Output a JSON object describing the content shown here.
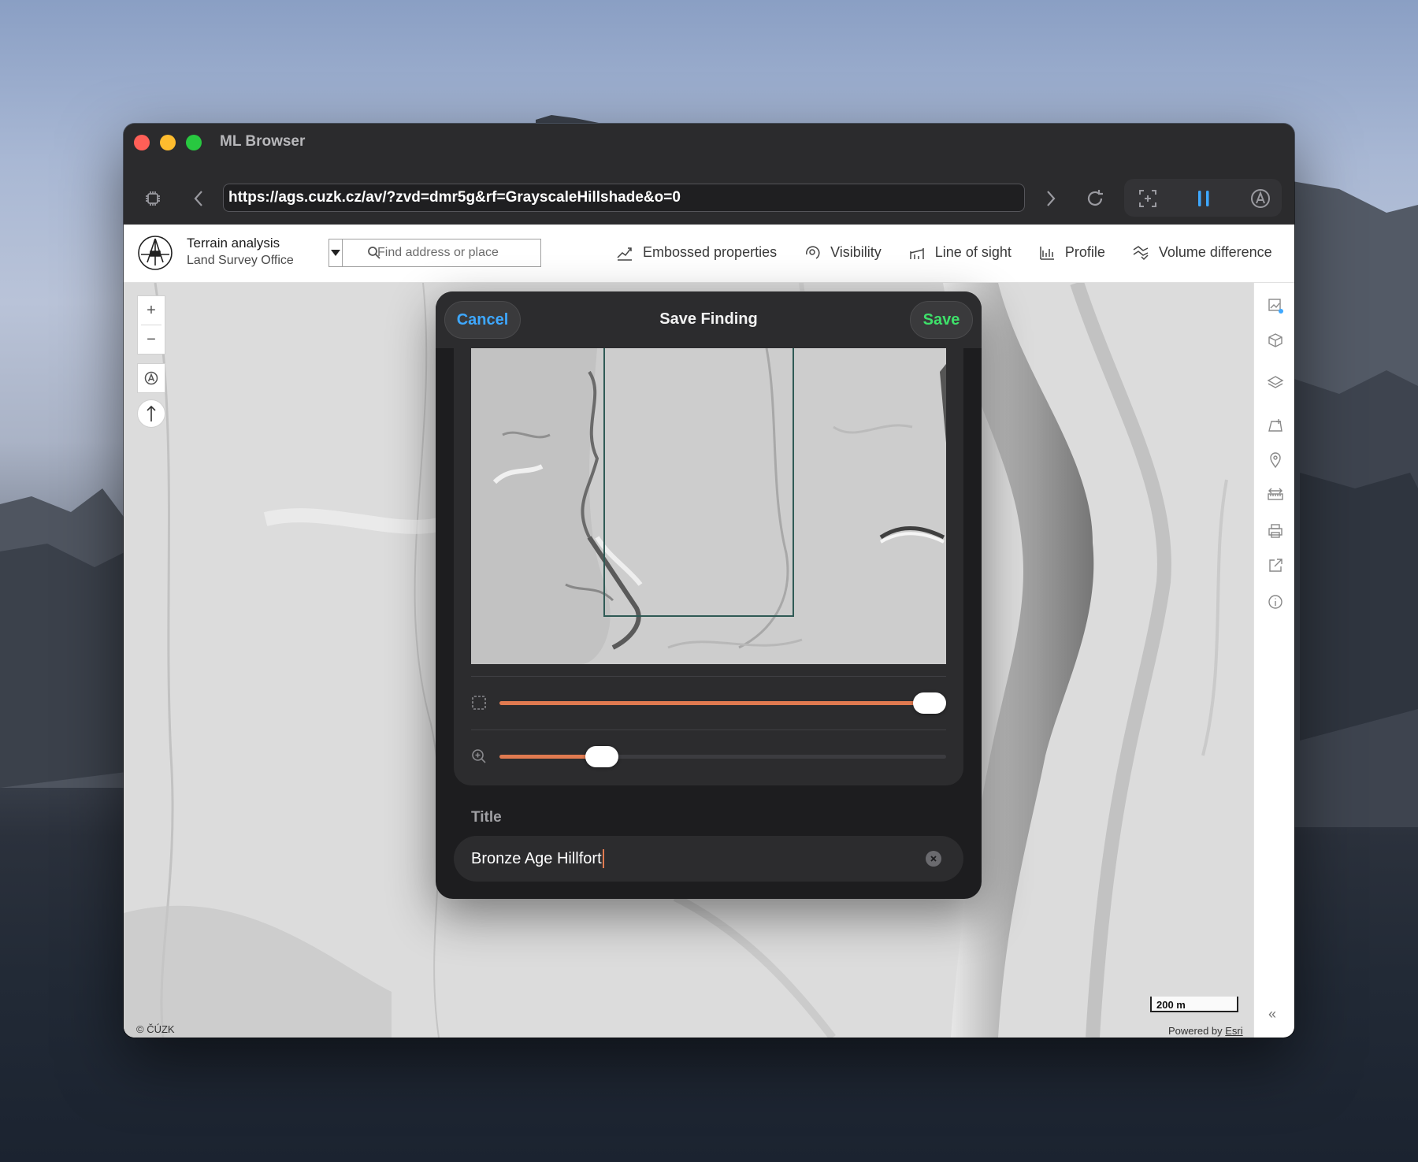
{
  "window": {
    "app_title": "ML Browser"
  },
  "toolbar": {
    "url": "https://ags.cuzk.cz/av/?zvd=dmr5g&rf=GrayscaleHillshade&o=0"
  },
  "app": {
    "title": "Terrain analysis",
    "subtitle": "Land Survey Office",
    "search_placeholder": "Find address or place",
    "nav": [
      {
        "label": "Embossed properties",
        "icon": "emboss-icon"
      },
      {
        "label": "Visibility",
        "icon": "visibility-icon"
      },
      {
        "label": "Line of sight",
        "icon": "line-of-sight-icon"
      },
      {
        "label": "Profile",
        "icon": "profile-icon"
      },
      {
        "label": "Volume difference",
        "icon": "volume-difference-icon"
      }
    ]
  },
  "map": {
    "zoom_in": "+",
    "zoom_out": "−",
    "scale_label": "200 m",
    "attribution_left": "© ČÚZK",
    "attribution_right_prefix": "Powered by ",
    "attribution_right_link": "Esri",
    "collapse": "«"
  },
  "modal": {
    "cancel_label": "Cancel",
    "title": "Save Finding",
    "save_label": "Save",
    "crop_slider_value": 0.97,
    "zoom_slider_value": 0.23,
    "title_label": "Title",
    "title_value": "Bronze Age Hillfort",
    "accent_color": "#e07a50",
    "cancel_color": "#3ea8ff",
    "save_color": "#3ee06a"
  }
}
